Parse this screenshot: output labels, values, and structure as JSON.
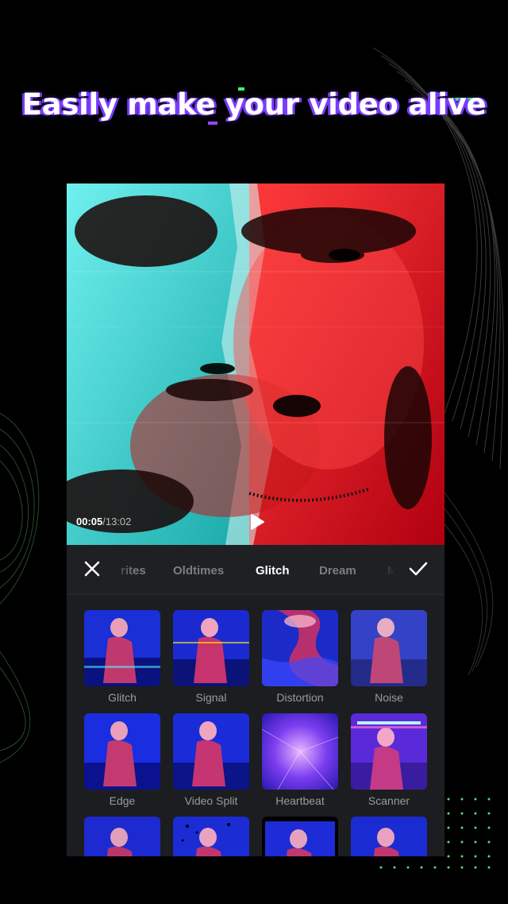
{
  "headline": "Easily make your video alive",
  "player": {
    "current_time": "00:05",
    "total_time": "/13:02"
  },
  "tabs": [
    {
      "label": "Favorites",
      "visible_text": "rites",
      "active": false
    },
    {
      "label": "Oldtimes",
      "visible_text": "Oldtimes",
      "active": false
    },
    {
      "label": "Glitch",
      "visible_text": "Glitch",
      "active": true
    },
    {
      "label": "Dream",
      "visible_text": "Dream",
      "active": false
    },
    {
      "label": "M",
      "visible_text": "M",
      "active": false
    }
  ],
  "effects": [
    {
      "label": "Glitch"
    },
    {
      "label": "Signal"
    },
    {
      "label": "Distortion"
    },
    {
      "label": "Noise"
    },
    {
      "label": "Edge"
    },
    {
      "label": "Video Split"
    },
    {
      "label": "Heartbeat"
    },
    {
      "label": "Scanner"
    },
    {
      "label": ""
    },
    {
      "label": ""
    },
    {
      "label": ""
    },
    {
      "label": ""
    }
  ],
  "icons": {
    "close": "close-icon",
    "confirm": "check-icon",
    "play": "play-icon"
  },
  "colors": {
    "background": "#000000",
    "panel": "#1c1d20",
    "accent_purple": "#7a3cff",
    "accent_green": "#3cff6a",
    "cyan": "#38d9d6",
    "red": "#e0141a"
  }
}
